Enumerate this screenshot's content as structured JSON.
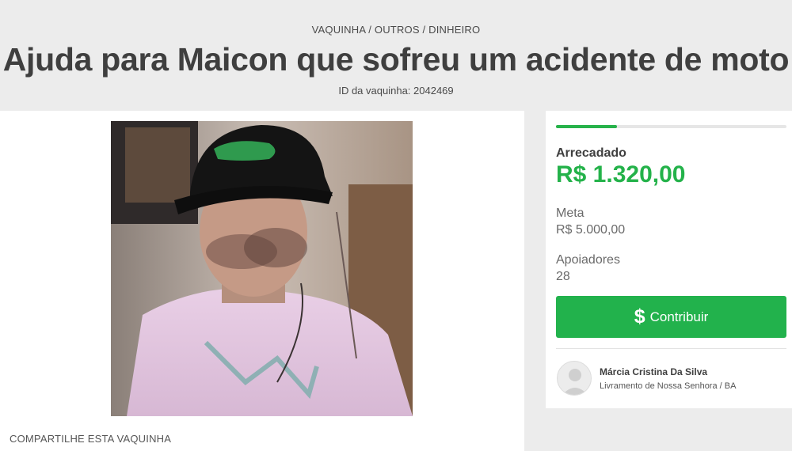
{
  "header": {
    "breadcrumb": "VAQUINHA / OUTROS / DINHEIRO",
    "title": "Ajuda para Maicon que sofreu um acidente de moto",
    "campaign_id": "ID da vaquinha: 2042469"
  },
  "main": {
    "photo_icon": "campaign-photo",
    "share_label": "COMPARTILHE ESTA VAQUINHA"
  },
  "sidebar": {
    "progress_fraction": 0.264,
    "raised_label": "Arrecadado",
    "raised_value": "R$ 1.320,00",
    "goal_label": "Meta",
    "goal_value": "R$ 5.000,00",
    "supporters_label": "Apoiadores",
    "supporters_value": "28",
    "contribute_icon": "dollar-icon",
    "contribute_label": "Contribuir",
    "organizer": {
      "avatar_icon": "user-avatar",
      "name": "Márcia Cristina Da Silva",
      "location": "Livramento de Nossa Senhora / BA"
    }
  },
  "colors": {
    "accent_green": "#22b24c",
    "page_background": "#ececec",
    "card_background": "#ffffff"
  }
}
